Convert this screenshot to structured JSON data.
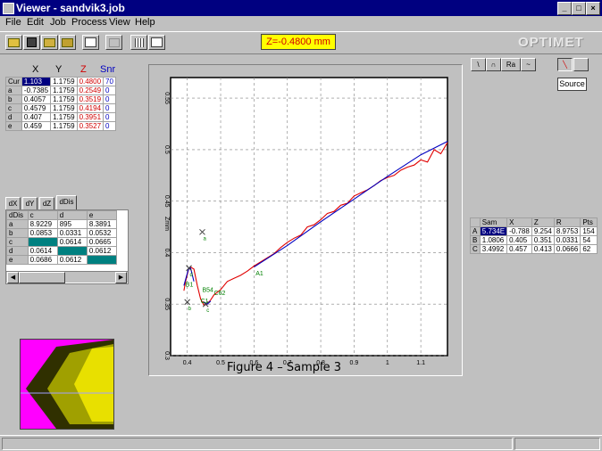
{
  "window": {
    "title": "Viewer - sandvik3.job"
  },
  "menu": [
    "File",
    "Edit",
    "Job",
    "Process",
    "View",
    "Help"
  ],
  "toolbar": {
    "z_readout": "Z=-0.4800 mm"
  },
  "logo": "OPTIMET",
  "cursor_table": {
    "headers": [
      "X",
      "Y",
      "Z",
      "Snr"
    ],
    "rows": [
      {
        "label": "Cur",
        "x": "1.103",
        "y": "1.1759",
        "z": "0.4800",
        "snr": "70"
      },
      {
        "label": "a",
        "x": "-0.7385",
        "y": "1.1759",
        "z": "0.2549",
        "snr": "0"
      },
      {
        "label": "b",
        "x": "0.4057",
        "y": "1.1759",
        "z": "0.3519",
        "snr": "0"
      },
      {
        "label": "c",
        "x": "0.4579",
        "y": "1.1759",
        "z": "0.4194",
        "snr": "0"
      },
      {
        "label": "d",
        "x": "0.407",
        "y": "1.1759",
        "z": "0.3951",
        "snr": "0"
      },
      {
        "label": "e",
        "x": "0.459",
        "y": "1.1759",
        "z": "0.3527",
        "snr": "0"
      }
    ]
  },
  "diff_tabs": [
    "dX",
    "dY",
    "dZ",
    "dDis"
  ],
  "diff_table": {
    "headers": [
      "dDis",
      "c",
      "d",
      "e"
    ],
    "rows": [
      {
        "label": "a",
        "c": "8.9229",
        "d": "895",
        "e": "8.3891"
      },
      {
        "label": "b",
        "c": "0.0853",
        "d": "0.0331",
        "e": "0.0532"
      },
      {
        "label": "c",
        "c": "",
        "d": "0.0614",
        "e": "0.0665"
      },
      {
        "label": "d",
        "c": "0.0614",
        "d": "",
        "e": "0.0612"
      },
      {
        "label": "e",
        "c": "0.0686",
        "d": "0.0612",
        "e": ""
      }
    ]
  },
  "mode_buttons": [
    "\\",
    "∩",
    "Ra",
    "~"
  ],
  "source_button": "Source",
  "right_table": {
    "headers": [
      "",
      "Sam",
      "X",
      "Z",
      "R",
      "Pts"
    ],
    "rows": [
      {
        "label": "A",
        "sam": "5.734E",
        "x": "-0.788",
        "z": "9.254",
        "r": "8.9753",
        "pts": "154"
      },
      {
        "label": "B",
        "sam": "1.0806",
        "x": "0.405",
        "z": "0.351",
        "r": "0.0331",
        "pts": "54"
      },
      {
        "label": "C",
        "sam": "3.4992",
        "x": "0.457",
        "z": "0.413",
        "r": "0.0666",
        "pts": "62"
      }
    ]
  },
  "caption": "Figure 4 – Sample 3",
  "chart_data": {
    "type": "line",
    "ylabel": "Zmm",
    "xlabel": "",
    "xlim": [
      0.35,
      1.18
    ],
    "ylim": [
      0.3,
      0.57
    ],
    "x_ticks": [
      0.4,
      0.5,
      0.6,
      0.7,
      0.8,
      0.9,
      1,
      1.1
    ],
    "x_tick_labels": [
      "0.4",
      "0.5",
      "0.6",
      "0.7",
      "0.8",
      "0.9",
      "1",
      "1.1"
    ],
    "y_ticks": [
      0.3,
      0.35,
      0.4,
      0.45,
      0.5,
      0.55
    ],
    "y_tick_labels": [
      "0.3",
      "0.35",
      "0.4",
      "0.45",
      "0.5",
      "0.55"
    ],
    "grid": true,
    "series": [
      {
        "color": "#e00000",
        "x": [
          0.39,
          0.395,
          0.405,
          0.41,
          0.42,
          0.43,
          0.44,
          0.45,
          0.46,
          0.47,
          0.48,
          0.5,
          0.52,
          0.54,
          0.56,
          0.58,
          0.6,
          0.62,
          0.64,
          0.66,
          0.68,
          0.7,
          0.72,
          0.74,
          0.76,
          0.78,
          0.8,
          0.82,
          0.84,
          0.86,
          0.88,
          0.9,
          0.92,
          0.94,
          0.96,
          0.98,
          1.0,
          1.02,
          1.04,
          1.06,
          1.08,
          1.1,
          1.12,
          1.14,
          1.16,
          1.18
        ],
        "y": [
          0.363,
          0.372,
          0.385,
          0.386,
          0.384,
          0.368,
          0.355,
          0.349,
          0.35,
          0.354,
          0.359,
          0.364,
          0.372,
          0.375,
          0.378,
          0.382,
          0.387,
          0.391,
          0.395,
          0.399,
          0.405,
          0.41,
          0.414,
          0.417,
          0.425,
          0.427,
          0.432,
          0.438,
          0.44,
          0.446,
          0.448,
          0.455,
          0.458,
          0.461,
          0.465,
          0.47,
          0.473,
          0.475,
          0.48,
          0.483,
          0.485,
          0.49,
          0.488,
          0.5,
          0.496,
          0.507
        ]
      },
      {
        "color": "#0000c0",
        "x": [
          0.39,
          0.4,
          0.405,
          0.41,
          0.42
        ],
        "y": [
          0.368,
          0.38,
          0.385,
          0.385,
          0.372
        ]
      },
      {
        "color": "#0000c0",
        "x": [
          0.45,
          0.46,
          0.47
        ],
        "y": [
          0.352,
          0.35,
          0.353
        ]
      },
      {
        "color": "#0000c0",
        "x": [
          0.6,
          0.7,
          0.8,
          0.9,
          1.0,
          1.1,
          1.18
        ],
        "y": [
          0.386,
          0.407,
          0.43,
          0.452,
          0.474,
          0.495,
          0.508
        ]
      }
    ],
    "markers": [
      {
        "label": "a",
        "x": 0.445,
        "y": 0.42,
        "symbol": "x"
      },
      {
        "label": "b",
        "x": 0.4,
        "y": 0.352,
        "symbol": "x"
      },
      {
        "label": "c",
        "x": 0.455,
        "y": 0.35,
        "symbol": "x"
      },
      {
        "label": "d",
        "x": 0.405,
        "y": 0.385,
        "symbol": "x"
      }
    ],
    "annotations": [
      {
        "text": "A1",
        "x": 0.605,
        "y": 0.378
      },
      {
        "text": "B1",
        "x": 0.395,
        "y": 0.367
      },
      {
        "text": "B54",
        "x": 0.445,
        "y": 0.362
      },
      {
        "text": "C1",
        "x": 0.44,
        "y": 0.351
      },
      {
        "text": "C62",
        "x": 0.48,
        "y": 0.359
      }
    ]
  },
  "colors": {
    "titlebar": "#000080",
    "zbox_bg": "#ffff00",
    "zbox_text": "#d00000",
    "series_red": "#e00000",
    "series_blue": "#0000c0",
    "annotation_green": "#008000",
    "selection": "#000080",
    "highlight_teal": "#008080",
    "thumbnail_magenta": "#ff00ff",
    "thumbnail_yellow": "#e8e000"
  }
}
